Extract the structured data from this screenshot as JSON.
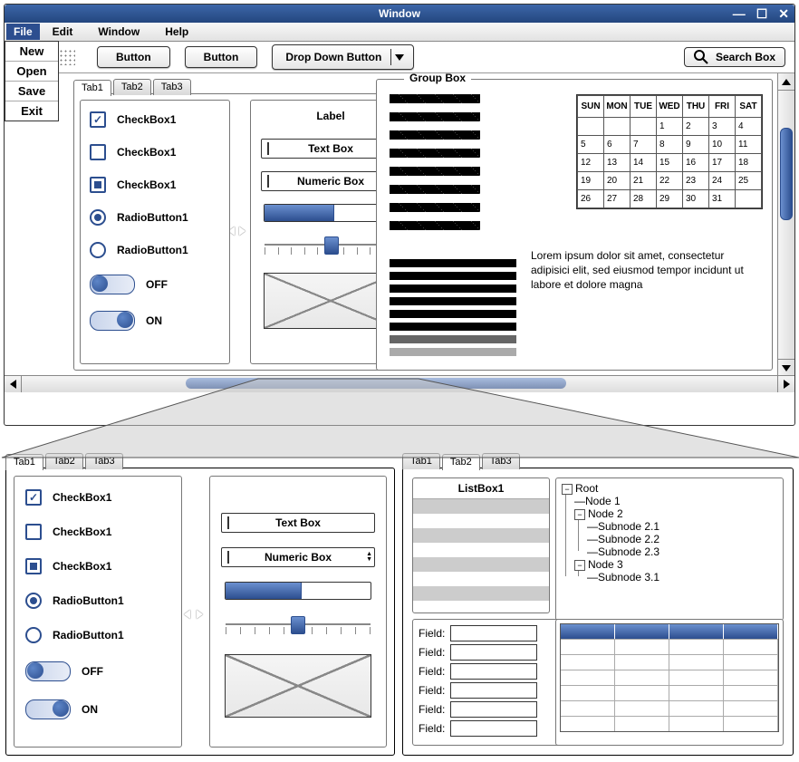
{
  "window": {
    "title": "Window",
    "min": "—",
    "max": "☐",
    "close": "✕"
  },
  "menus": {
    "file": "File",
    "edit": "Edit",
    "window": "Window",
    "help": "Help"
  },
  "file_dropdown": [
    "New",
    "Open",
    "Save",
    "Exit"
  ],
  "toolbar": {
    "btn1": "Button",
    "btn2": "Button",
    "dropdown": "Drop Down Button",
    "search": "Search Box"
  },
  "tabs": [
    "Tab1",
    "Tab2",
    "Tab3"
  ],
  "checks": {
    "c1": "CheckBox1",
    "c2": "CheckBox1",
    "c3": "CheckBox1"
  },
  "radios": {
    "r1": "RadioButton1",
    "r2": "RadioButton1"
  },
  "toggle": {
    "off": "OFF",
    "on": "ON"
  },
  "mid": {
    "label": "Label",
    "text": "Text Box",
    "num": "Numeric Box"
  },
  "group": {
    "title": "Group Box"
  },
  "calendar": {
    "days": [
      "SUN",
      "MON",
      "TUE",
      "WED",
      "THU",
      "FRI",
      "SAT"
    ],
    "rows": [
      [
        "",
        "",
        "",
        "1",
        "2",
        "3",
        "4"
      ],
      [
        "5",
        "6",
        "7",
        "8",
        "9",
        "10",
        "11"
      ],
      [
        "12",
        "13",
        "14",
        "15",
        "16",
        "17",
        "18"
      ],
      [
        "19",
        "20",
        "21",
        "22",
        "23",
        "24",
        "25"
      ],
      [
        "26",
        "27",
        "28",
        "29",
        "30",
        "31",
        ""
      ]
    ]
  },
  "lorem": "Lorem ipsum dolor sit amet, consectetur adipisici elit, sed eiusmod tempor incidunt ut labore et dolore magna",
  "listbox": {
    "title": "ListBox1"
  },
  "tree": {
    "root": "Root",
    "n1": "Node 1",
    "n2": "Node 2",
    "s21": "Subnode 2.1",
    "s22": "Subnode 2.2",
    "s23": "Subnode 2.3",
    "n3": "Node 3",
    "s31": "Subnode 3.1"
  },
  "field_label": "Field:"
}
